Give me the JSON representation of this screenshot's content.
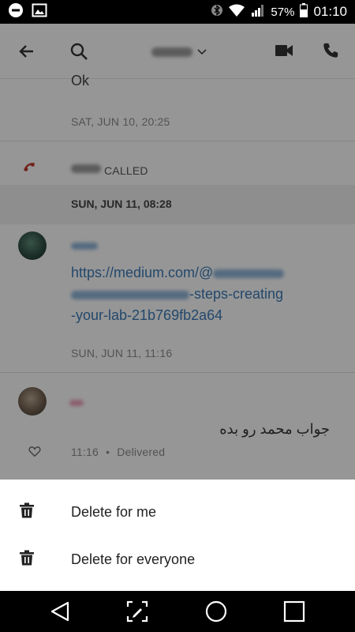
{
  "status_bar": {
    "battery": "57%",
    "time": "01:10",
    "icons": [
      "do-not-disturb-icon",
      "image-icon",
      "bluetooth-icon",
      "wifi-icon",
      "signal-icon",
      "battery-icon"
    ]
  },
  "header": {
    "icons": [
      "back-arrow-icon",
      "search-icon",
      "chevron-down-icon",
      "video-call-icon",
      "phone-icon"
    ]
  },
  "conversation": {
    "message_1": {
      "text": "Ok",
      "timestamp": "SAT, JUN 10, 20:25"
    },
    "call": {
      "label": "CALLED"
    },
    "date_separator": "SUN, JUN 11, 08:28",
    "message_2": {
      "link_line1": "https://medium.com/@",
      "link_line2": "-steps-creating",
      "link_line3": "-your-lab-21b769fb2a64",
      "timestamp": "SUN, JUN 11, 11:16"
    },
    "message_3": {
      "text": "جواب محمد رو بده",
      "time": "11:16",
      "separator": "•",
      "status": "Delivered"
    }
  },
  "sheet": {
    "items": [
      {
        "label": "Delete for me",
        "icon": "trash-icon"
      },
      {
        "label": "Delete for everyone",
        "icon": "trash-icon"
      }
    ]
  },
  "navbar": {
    "icons": [
      "back-triangle-icon",
      "edit-screen-icon",
      "home-circle-icon",
      "recents-square-icon"
    ]
  },
  "colors": {
    "link": "#3b78b5",
    "call_icon": "#c0392b",
    "overlay": "rgba(0,0,0,0.40)"
  }
}
